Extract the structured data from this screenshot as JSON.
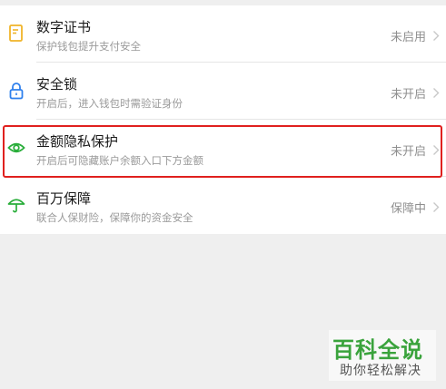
{
  "settings": {
    "items": [
      {
        "title": "数字证书",
        "subtitle": "保护钱包提升支付安全",
        "status": "未启用",
        "icon": "certificate-icon",
        "icon_color": "#f0b429"
      },
      {
        "title": "安全锁",
        "subtitle": "开启后，进入钱包时需验证身份",
        "status": "未开启",
        "icon": "lock-icon",
        "icon_color": "#2f80ed"
      },
      {
        "title": "金额隐私保护",
        "subtitle": "开启后可隐藏账户余额入口下方金额",
        "status": "未开启",
        "icon": "eye-icon",
        "icon_color": "#2aae3b"
      },
      {
        "title": "百万保障",
        "subtitle": "联合人保财险，保障你的资金安全",
        "status": "保障中",
        "icon": "umbrella-icon",
        "icon_color": "#2aae3b"
      }
    ]
  },
  "highlight": {
    "color": "#e0201e"
  },
  "watermark": {
    "title": "百科全说",
    "subtitle": "助你轻松解决"
  }
}
